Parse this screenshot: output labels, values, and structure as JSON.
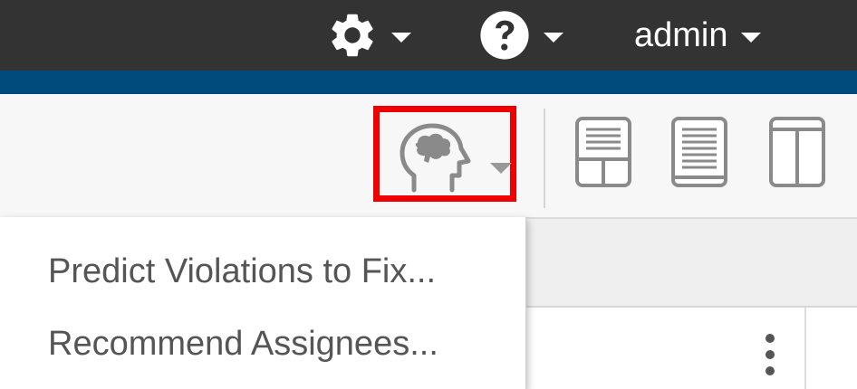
{
  "header": {
    "user_label": "admin",
    "icons": {
      "settings": "gear-icon",
      "help": "help-icon",
      "caret": "caret-down-icon"
    }
  },
  "toolbar": {
    "ai_button_icon": "ai-brain-head-icon",
    "layout_buttons": [
      "layout-split-bottom-icon",
      "layout-list-icon",
      "layout-columns-icon"
    ]
  },
  "menu": {
    "items": [
      {
        "label": "Predict Violations to Fix..."
      },
      {
        "label": "Recommend Assignees..."
      }
    ]
  },
  "colors": {
    "header_bg": "#333333",
    "accent_stripe": "#004a7c",
    "highlight_border": "#ee0000",
    "menu_text": "#555555",
    "icon_grey": "#8a8a8a"
  }
}
